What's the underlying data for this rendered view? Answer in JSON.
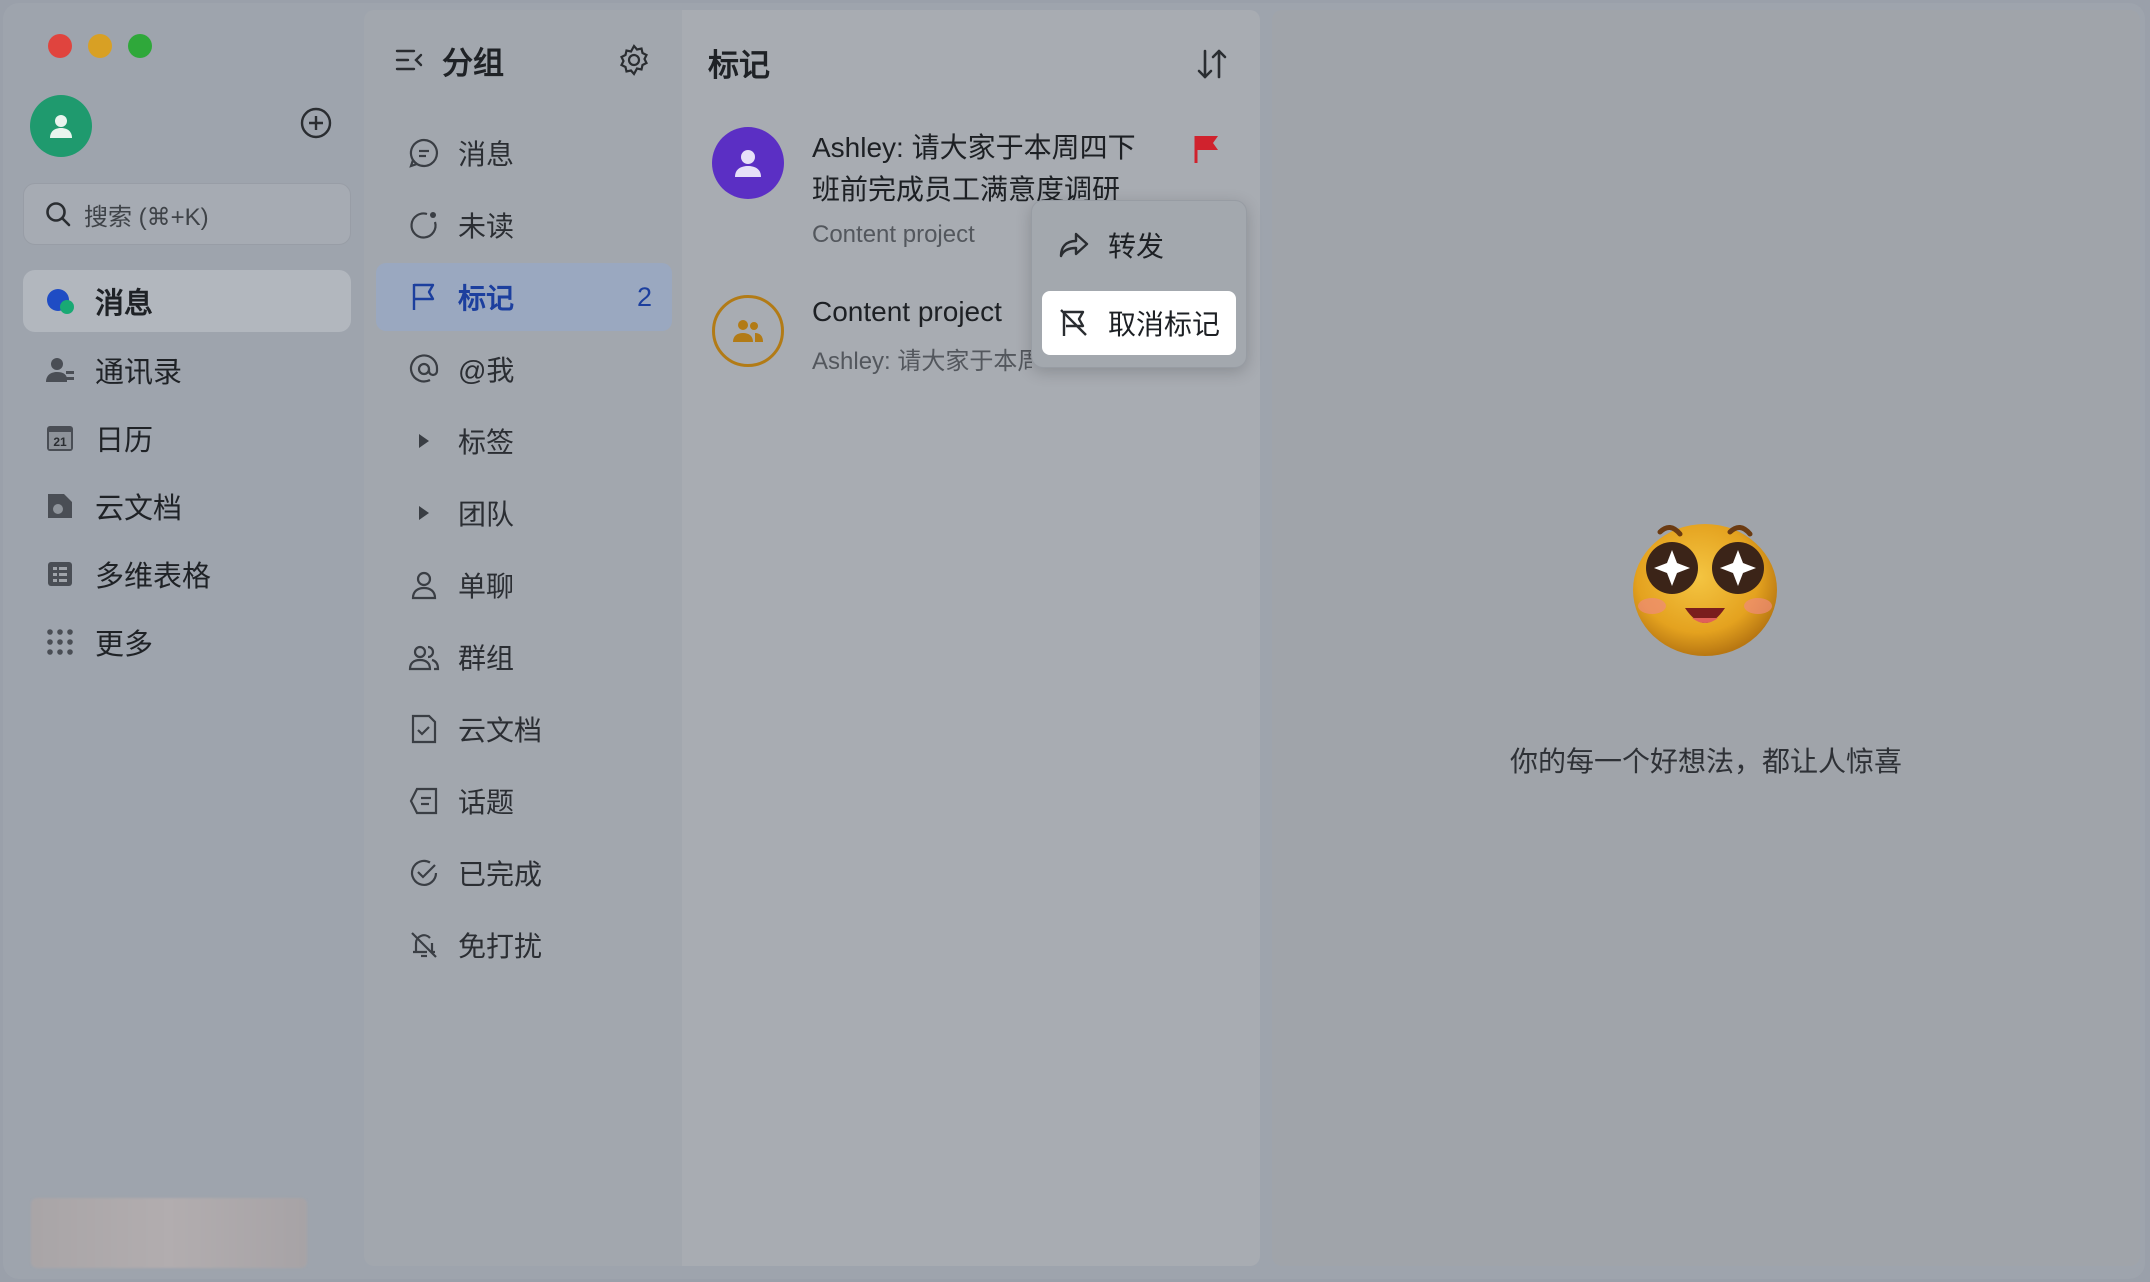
{
  "window": {
    "traffic_lights": [
      "close",
      "minimize",
      "zoom"
    ]
  },
  "sidebar": {
    "search_placeholder": "搜索 (⌘+K)",
    "items": [
      {
        "label": "消息",
        "icon": "chat-bubble-icon",
        "active": true
      },
      {
        "label": "通讯录",
        "icon": "contacts-icon"
      },
      {
        "label": "日历",
        "icon": "calendar-icon",
        "icon_text": "21"
      },
      {
        "label": "云文档",
        "icon": "docs-icon"
      },
      {
        "label": "多维表格",
        "icon": "table-icon"
      },
      {
        "label": "更多",
        "icon": "grid-dots-icon"
      }
    ]
  },
  "groups": {
    "title": "分组",
    "items": [
      {
        "label": "消息",
        "icon": "message-icon"
      },
      {
        "label": "未读",
        "icon": "unread-icon"
      },
      {
        "label": "标记",
        "icon": "flag-icon",
        "badge": "2",
        "active": true
      },
      {
        "label": "@我",
        "icon": "at-icon"
      },
      {
        "label": "标签",
        "icon": "caret-right-icon"
      },
      {
        "label": "团队",
        "icon": "caret-right-icon"
      },
      {
        "label": "单聊",
        "icon": "person-icon"
      },
      {
        "label": "群组",
        "icon": "group-icon"
      },
      {
        "label": "云文档",
        "icon": "doc-icon"
      },
      {
        "label": "话题",
        "icon": "topic-icon"
      },
      {
        "label": "已完成",
        "icon": "done-icon"
      },
      {
        "label": "免打扰",
        "icon": "mute-icon"
      }
    ]
  },
  "list": {
    "title": "标记",
    "chats": [
      {
        "title_line1": "Ashley: 请大家于本周四下",
        "title_line2": "班前完成员工满意度调研",
        "subtitle": "Content project",
        "avatar_color": "#5b2fc4",
        "flagged": true
      },
      {
        "title_line1": "Content project",
        "subtitle": "Ashley: 请大家于本周",
        "avatar_color": "#b27b16"
      }
    ]
  },
  "context_menu": {
    "items": [
      {
        "label": "转发",
        "icon": "forward-icon"
      },
      {
        "label": "取消标记",
        "icon": "unflag-icon",
        "highlighted": true
      }
    ]
  },
  "empty_state": {
    "text": "你的每一个好想法，都让人惊喜"
  },
  "colors": {
    "accent": "#1c3f9e",
    "flag": "#d0222d"
  }
}
